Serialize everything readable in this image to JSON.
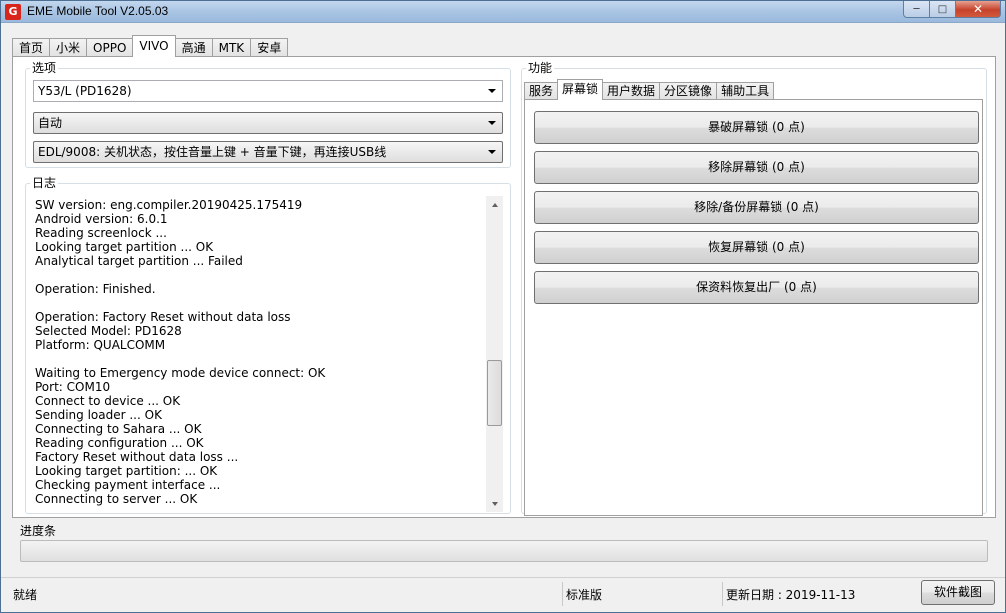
{
  "window": {
    "title": "EME Mobile Tool V2.05.03",
    "icon_letter": "G"
  },
  "top_tabs": [
    "首页",
    "小米",
    "OPPO",
    "VIVO",
    "高通",
    "MTK",
    "安卓"
  ],
  "active_top_tab": "VIVO",
  "options": {
    "label": "选项",
    "model_select": "Y53/L (PD1628)",
    "mode_select": "自动",
    "connect_select": "EDL/9008: 关机状态，按住音量上键 + 音量下键，再连接USB线"
  },
  "log": {
    "label": "日志",
    "lines": [
      "SW version: eng.compiler.20190425.175419",
      "Android version: 6.0.1",
      "Reading screenlock ...",
      "Looking target partition ... OK",
      "Analytical target partition ... Failed",
      "",
      "Operation: Finished.",
      "",
      "Operation: Factory Reset without data loss",
      "Selected Model:  PD1628",
      "Platform:  QUALCOMM",
      "",
      "Waiting to Emergency mode device connect: OK",
      "Port: COM10",
      "Connect to device ... OK",
      "Sending loader ... OK",
      "Connecting to Sahara ... OK",
      "Reading configuration ... OK",
      "Factory Reset without data loss ...",
      "Looking target partition: ... OK",
      "Checking payment interface ...",
      "Connecting to server ... OK"
    ]
  },
  "functions": {
    "label": "功能",
    "tabs": [
      "服务",
      "屏幕锁",
      "用户数据",
      "分区镜像",
      "辅助工具"
    ],
    "active_tab": "屏幕锁",
    "buttons": [
      "暴破屏幕锁 (0 点)",
      "移除屏幕锁 (0 点)",
      "移除/备份屏幕锁 (0 点)",
      "恢复屏幕锁 (0 点)",
      "保资料恢复出厂 (0 点)"
    ]
  },
  "progress": {
    "label": "进度条",
    "value_percent": 0
  },
  "status": {
    "state": "就绪",
    "edition": "标准版",
    "update_date": "更新日期 : 2019-11-13",
    "screenshot_button": "软件截图"
  },
  "colors": {
    "close_button": "#c6432b",
    "icon_red": "#d9261c",
    "titlebar": "#aac5e4"
  }
}
